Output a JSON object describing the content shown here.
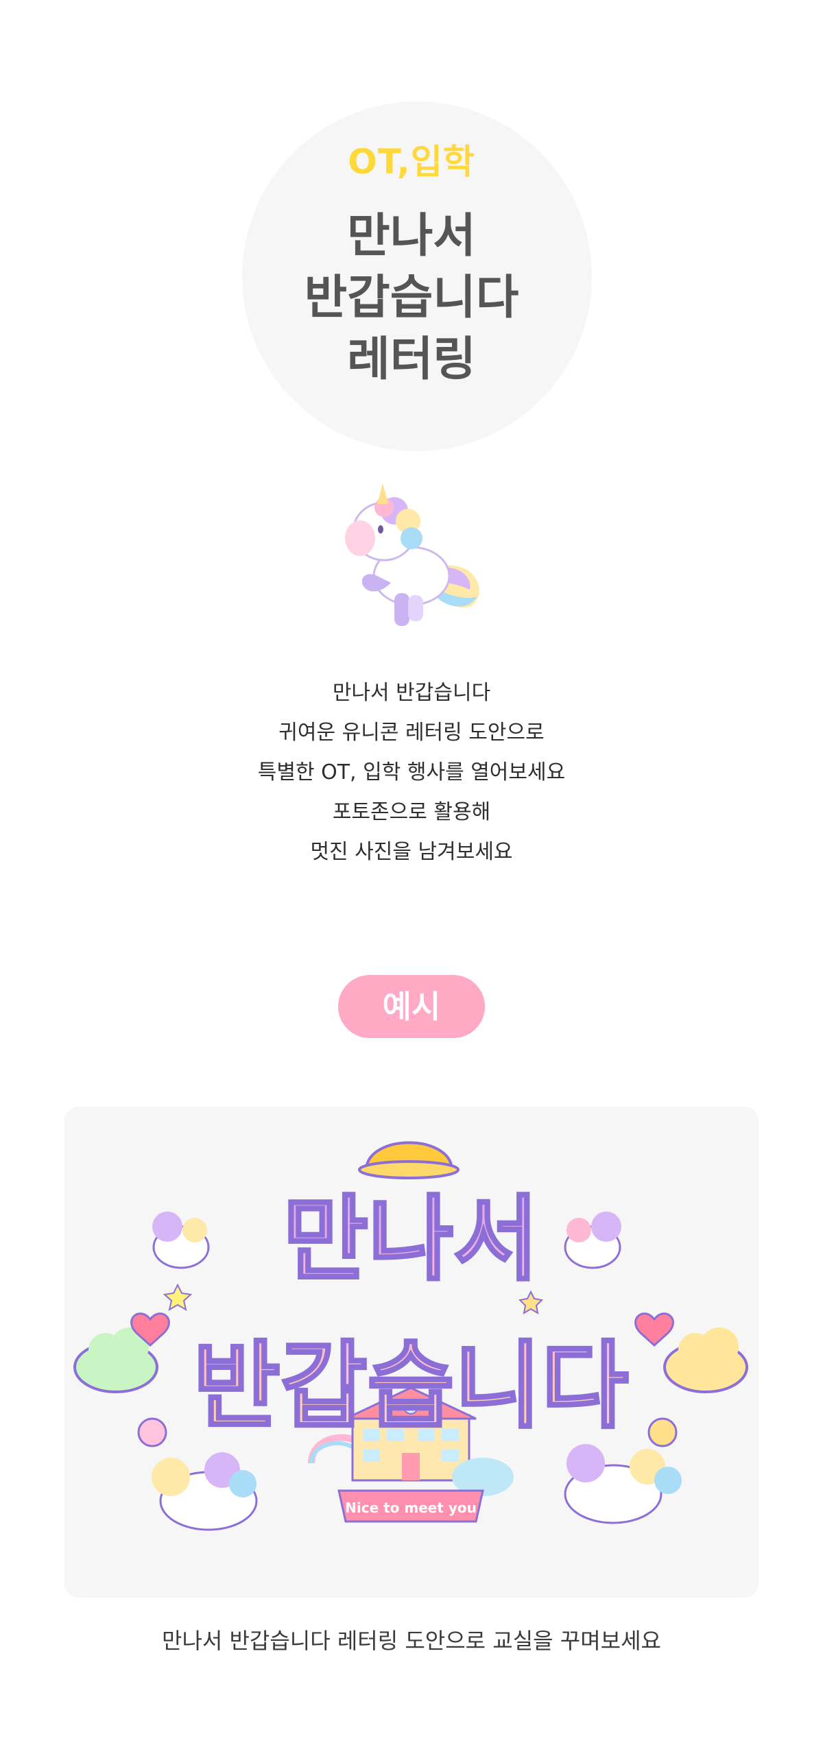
{
  "hero": {
    "category": "OT,입학",
    "title_lines": [
      "만나서",
      "반갑습니다",
      "레터링"
    ]
  },
  "description": {
    "lines": [
      "만나서 반갑습니다",
      "귀여운 유니콘 레터링 도안으로",
      "특별한 OT, 입학 행사를 열어보세요",
      "포토존으로 활용해",
      "멋진 사진을 남겨보세요"
    ]
  },
  "example": {
    "label": "예시",
    "lettering_line1": "만나서",
    "lettering_line2": "반갑습니다",
    "banner_text": "Nice to meet you",
    "caption": "만나서 반갑습니다 레터링 도안으로 교실을 꾸며보세요"
  },
  "colors": {
    "accent_yellow": "#ffd93b",
    "title_gray": "#555555",
    "pill_pink": "#ffa9c5",
    "panel_gray": "#f6f6f6",
    "lettering_purple": "#d9a6f2",
    "lettering_peach": "#ffd0a8",
    "outline_purple": "#8b6fd6"
  }
}
